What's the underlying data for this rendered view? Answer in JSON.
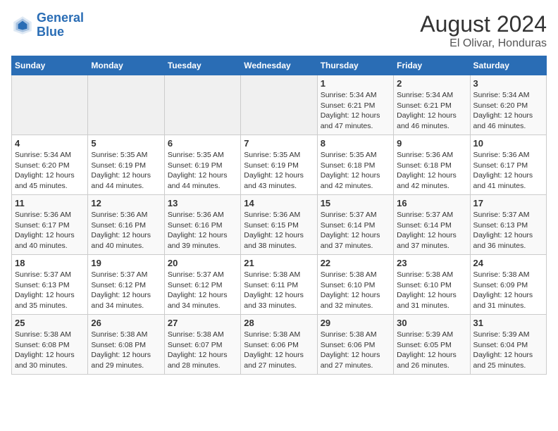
{
  "header": {
    "logo_line1": "General",
    "logo_line2": "Blue",
    "month_year": "August 2024",
    "location": "El Olivar, Honduras"
  },
  "weekdays": [
    "Sunday",
    "Monday",
    "Tuesday",
    "Wednesday",
    "Thursday",
    "Friday",
    "Saturday"
  ],
  "weeks": [
    [
      {
        "day": "",
        "info": ""
      },
      {
        "day": "",
        "info": ""
      },
      {
        "day": "",
        "info": ""
      },
      {
        "day": "",
        "info": ""
      },
      {
        "day": "1",
        "info": "Sunrise: 5:34 AM\nSunset: 6:21 PM\nDaylight: 12 hours\nand 47 minutes."
      },
      {
        "day": "2",
        "info": "Sunrise: 5:34 AM\nSunset: 6:21 PM\nDaylight: 12 hours\nand 46 minutes."
      },
      {
        "day": "3",
        "info": "Sunrise: 5:34 AM\nSunset: 6:20 PM\nDaylight: 12 hours\nand 46 minutes."
      }
    ],
    [
      {
        "day": "4",
        "info": "Sunrise: 5:34 AM\nSunset: 6:20 PM\nDaylight: 12 hours\nand 45 minutes."
      },
      {
        "day": "5",
        "info": "Sunrise: 5:35 AM\nSunset: 6:19 PM\nDaylight: 12 hours\nand 44 minutes."
      },
      {
        "day": "6",
        "info": "Sunrise: 5:35 AM\nSunset: 6:19 PM\nDaylight: 12 hours\nand 44 minutes."
      },
      {
        "day": "7",
        "info": "Sunrise: 5:35 AM\nSunset: 6:19 PM\nDaylight: 12 hours\nand 43 minutes."
      },
      {
        "day": "8",
        "info": "Sunrise: 5:35 AM\nSunset: 6:18 PM\nDaylight: 12 hours\nand 42 minutes."
      },
      {
        "day": "9",
        "info": "Sunrise: 5:36 AM\nSunset: 6:18 PM\nDaylight: 12 hours\nand 42 minutes."
      },
      {
        "day": "10",
        "info": "Sunrise: 5:36 AM\nSunset: 6:17 PM\nDaylight: 12 hours\nand 41 minutes."
      }
    ],
    [
      {
        "day": "11",
        "info": "Sunrise: 5:36 AM\nSunset: 6:17 PM\nDaylight: 12 hours\nand 40 minutes."
      },
      {
        "day": "12",
        "info": "Sunrise: 5:36 AM\nSunset: 6:16 PM\nDaylight: 12 hours\nand 40 minutes."
      },
      {
        "day": "13",
        "info": "Sunrise: 5:36 AM\nSunset: 6:16 PM\nDaylight: 12 hours\nand 39 minutes."
      },
      {
        "day": "14",
        "info": "Sunrise: 5:36 AM\nSunset: 6:15 PM\nDaylight: 12 hours\nand 38 minutes."
      },
      {
        "day": "15",
        "info": "Sunrise: 5:37 AM\nSunset: 6:14 PM\nDaylight: 12 hours\nand 37 minutes."
      },
      {
        "day": "16",
        "info": "Sunrise: 5:37 AM\nSunset: 6:14 PM\nDaylight: 12 hours\nand 37 minutes."
      },
      {
        "day": "17",
        "info": "Sunrise: 5:37 AM\nSunset: 6:13 PM\nDaylight: 12 hours\nand 36 minutes."
      }
    ],
    [
      {
        "day": "18",
        "info": "Sunrise: 5:37 AM\nSunset: 6:13 PM\nDaylight: 12 hours\nand 35 minutes."
      },
      {
        "day": "19",
        "info": "Sunrise: 5:37 AM\nSunset: 6:12 PM\nDaylight: 12 hours\nand 34 minutes."
      },
      {
        "day": "20",
        "info": "Sunrise: 5:37 AM\nSunset: 6:12 PM\nDaylight: 12 hours\nand 34 minutes."
      },
      {
        "day": "21",
        "info": "Sunrise: 5:38 AM\nSunset: 6:11 PM\nDaylight: 12 hours\nand 33 minutes."
      },
      {
        "day": "22",
        "info": "Sunrise: 5:38 AM\nSunset: 6:10 PM\nDaylight: 12 hours\nand 32 minutes."
      },
      {
        "day": "23",
        "info": "Sunrise: 5:38 AM\nSunset: 6:10 PM\nDaylight: 12 hours\nand 31 minutes."
      },
      {
        "day": "24",
        "info": "Sunrise: 5:38 AM\nSunset: 6:09 PM\nDaylight: 12 hours\nand 31 minutes."
      }
    ],
    [
      {
        "day": "25",
        "info": "Sunrise: 5:38 AM\nSunset: 6:08 PM\nDaylight: 12 hours\nand 30 minutes."
      },
      {
        "day": "26",
        "info": "Sunrise: 5:38 AM\nSunset: 6:08 PM\nDaylight: 12 hours\nand 29 minutes."
      },
      {
        "day": "27",
        "info": "Sunrise: 5:38 AM\nSunset: 6:07 PM\nDaylight: 12 hours\nand 28 minutes."
      },
      {
        "day": "28",
        "info": "Sunrise: 5:38 AM\nSunset: 6:06 PM\nDaylight: 12 hours\nand 27 minutes."
      },
      {
        "day": "29",
        "info": "Sunrise: 5:38 AM\nSunset: 6:06 PM\nDaylight: 12 hours\nand 27 minutes."
      },
      {
        "day": "30",
        "info": "Sunrise: 5:39 AM\nSunset: 6:05 PM\nDaylight: 12 hours\nand 26 minutes."
      },
      {
        "day": "31",
        "info": "Sunrise: 5:39 AM\nSunset: 6:04 PM\nDaylight: 12 hours\nand 25 minutes."
      }
    ]
  ]
}
